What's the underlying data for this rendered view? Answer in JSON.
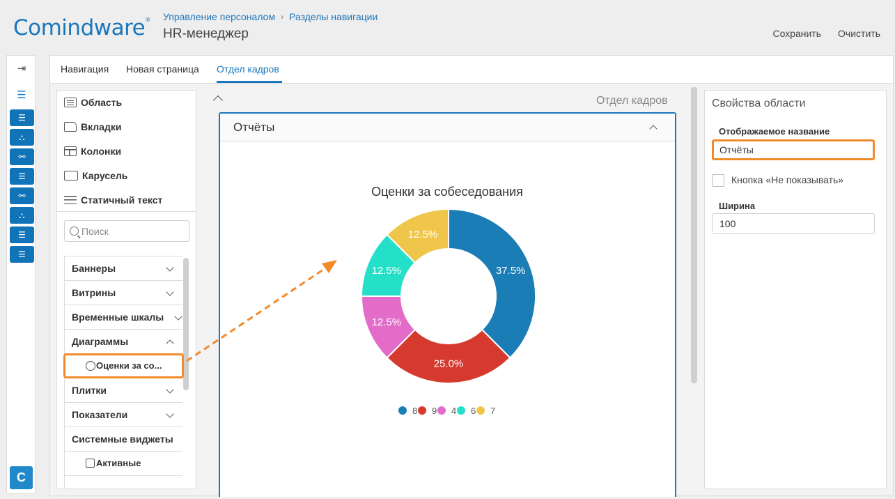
{
  "app": {
    "logo_text": "Comindware",
    "logo_mark": "®",
    "breadcrumbs": [
      "Управление персоналом",
      "Разделы навигации"
    ],
    "title": "HR-менеджер",
    "actions": [
      "Сохранить",
      "Очистить"
    ]
  },
  "rail": {
    "buttons": [
      "list-icon",
      "hierarchy-icon",
      "flow-icon",
      "list-icon",
      "flow-icon",
      "hierarchy-icon",
      "list-icon",
      "list-icon"
    ],
    "bottom_label": "C"
  },
  "tabs": [
    {
      "label": "Навигация",
      "active": false
    },
    {
      "label": "Новая страница",
      "active": false
    },
    {
      "label": "Отдел кадров",
      "active": true
    }
  ],
  "palette": {
    "top_items": [
      "Область",
      "Вкладки",
      "Колонки",
      "Карусель",
      "Статичный текст"
    ],
    "search_placeholder": "Поиск",
    "groups": [
      {
        "label": "Баннеры",
        "expanded": false
      },
      {
        "label": "Витрины",
        "expanded": false
      },
      {
        "label": "Временные шкалы",
        "expanded": false
      },
      {
        "label": "Диаграммы",
        "expanded": true,
        "children": [
          "Оценки за со..."
        ]
      },
      {
        "label": "Плитки",
        "expanded": false
      },
      {
        "label": "Показатели",
        "expanded": false
      },
      {
        "label": "Системные виджеты",
        "expanded": true,
        "children": [
          "Активные"
        ]
      }
    ]
  },
  "canvas": {
    "area_caption": "Отдел кадров",
    "card_title": "Отчёты"
  },
  "chart_data": {
    "type": "pie",
    "variant": "donut",
    "title": "Оценки за собеседования",
    "categories": [
      "8",
      "9",
      "4",
      "6",
      "7"
    ],
    "values": [
      37.5,
      25.0,
      12.5,
      12.5,
      12.5
    ],
    "labels": [
      "37.5%",
      "25.0%",
      "12.5%",
      "12.5%",
      "12.5%"
    ],
    "colors": [
      "#1b7db5",
      "#d63a2f",
      "#e26cc8",
      "#25e0c8",
      "#f0c64a"
    ],
    "legend_position": "bottom"
  },
  "properties": {
    "title": "Свойства области",
    "display_name_label": "Отображаемое название",
    "display_name_value": "Отчёты",
    "hide_button_label": "Кнопка «Не показывать»",
    "width_label": "Ширина",
    "width_value": "100"
  }
}
